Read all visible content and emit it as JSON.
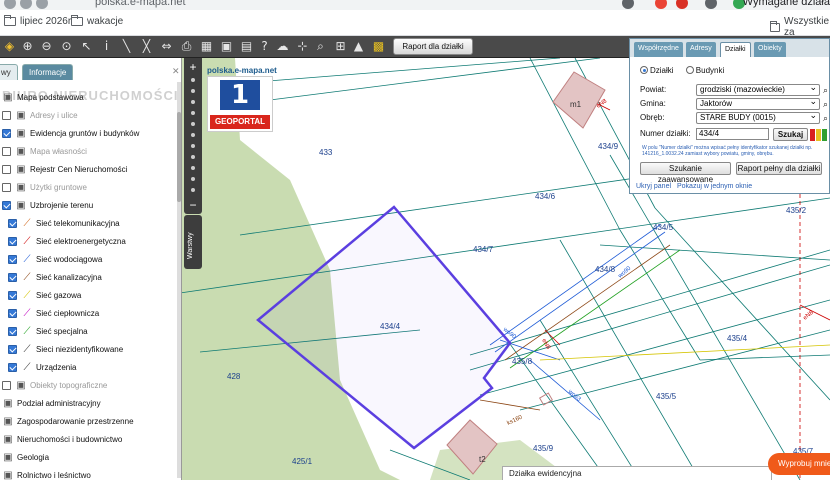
{
  "browser": {
    "url": "polska.e-mapa.net",
    "cta": "Wymagane działa",
    "bookmarks": [
      {
        "label": "lipiec 2026r"
      },
      {
        "label": "wakacje"
      },
      {
        "label": "Wszystkie za"
      }
    ]
  },
  "toolbar": {
    "raport_button": "Raport dla działki",
    "icons": [
      "layers-icon",
      "zoom-in-icon",
      "zoom-out-icon",
      "zoom-extent-icon",
      "pointer-icon",
      "info-icon",
      "measure-line-icon",
      "measure-area-icon",
      "pan-icon",
      "print-icon",
      "layout-icon",
      "bus-icon",
      "help-icon",
      "cloud-icon",
      "triangle-icon",
      "search-icon",
      "cart-icon",
      "grid-icon"
    ]
  },
  "watermark": "BIURO NIERUCHOMOŚCI",
  "left_panel": {
    "tabs": [
      {
        "label": "wy"
      },
      {
        "label": "Informacje"
      }
    ],
    "layers": [
      {
        "label": "Mapa podstawowa",
        "checked": null,
        "grey": false,
        "indent": 0
      },
      {
        "label": "Adresy i ulice",
        "checked": false,
        "grey": true,
        "indent": 0
      },
      {
        "label": "Ewidencja gruntów i budynków",
        "checked": true,
        "grey": false,
        "indent": 0
      },
      {
        "label": "Mapa własności",
        "checked": false,
        "grey": true,
        "indent": 0
      },
      {
        "label": "Rejestr Cen Nieruchomości",
        "checked": false,
        "grey": false,
        "indent": 0
      },
      {
        "label": "Użytki gruntowe",
        "checked": false,
        "grey": true,
        "indent": 0
      },
      {
        "label": "Uzbrojenie terenu",
        "checked": true,
        "grey": false,
        "indent": 0
      },
      {
        "label": "Sieć telekomunikacyjna",
        "checked": true,
        "grey": false,
        "indent": 1,
        "color": "#d2691e"
      },
      {
        "label": "Sieć elektroenergetyczna",
        "checked": true,
        "grey": false,
        "indent": 1,
        "color": "#cc0000"
      },
      {
        "label": "Sieć wodociągowa",
        "checked": true,
        "grey": false,
        "indent": 1,
        "color": "#1e5bd6"
      },
      {
        "label": "Sieć kanalizacyjna",
        "checked": true,
        "grey": false,
        "indent": 1,
        "color": "#8b4513"
      },
      {
        "label": "Sieć gazowa",
        "checked": true,
        "grey": false,
        "indent": 1,
        "color": "#d4c400"
      },
      {
        "label": "Sieć ciepłownicza",
        "checked": true,
        "grey": false,
        "indent": 1,
        "color": "#c000c0"
      },
      {
        "label": "Sieć specjalna",
        "checked": true,
        "grey": false,
        "indent": 1,
        "color": "#20a020"
      },
      {
        "label": "Sieci niezidentyfikowane",
        "checked": true,
        "grey": false,
        "indent": 1,
        "color": "#333333"
      },
      {
        "label": "Urządzenia",
        "checked": true,
        "grey": false,
        "indent": 1,
        "color": "#333333"
      },
      {
        "label": "Obiekty topograficzne",
        "checked": false,
        "grey": true,
        "indent": 0
      },
      {
        "label": "Podział administracyjny",
        "checked": null,
        "grey": false,
        "indent": 0
      },
      {
        "label": "Zagospodarowanie przestrzenne",
        "checked": null,
        "grey": false,
        "indent": 0
      },
      {
        "label": "Nieruchomości i budownictwo",
        "checked": null,
        "grey": false,
        "indent": 0
      },
      {
        "label": "Geologia",
        "checked": null,
        "grey": false,
        "indent": 0
      },
      {
        "label": "Rolnictwo i leśnictwo",
        "checked": null,
        "grey": false,
        "indent": 0
      },
      {
        "label": "Hydrografia",
        "checked": null,
        "grey": false,
        "indent": 0
      }
    ]
  },
  "warstwy_label": "Warstwy",
  "site_tag": "polska.e-mapa.net",
  "geoportal": {
    "number": "1",
    "label": "GEOPORTAL"
  },
  "search_panel": {
    "tabs": [
      {
        "label": "Współrzędne"
      },
      {
        "label": "Adresy"
      },
      {
        "label": "Działki",
        "active": true
      },
      {
        "label": "Obiekty"
      }
    ],
    "radio_dzialki": "Działki",
    "radio_budynki": "Budynki",
    "powiat_label": "Powiat:",
    "powiat_value": "grodziski (mazowieckie)",
    "gmina_label": "Gmina:",
    "gmina_value": "Jaktorów",
    "obreb_label": "Obręb:",
    "obreb_value": "STARE BUDY (0015)",
    "numer_label": "Numer działki:",
    "numer_value": "434/4",
    "szukaj_button": "Szukaj",
    "note": "W polu \"Numer działki\" można wpisać pełny identyfikator szukanej działki np. 141216_1.0032.24 zamiast wybory powiatu, gminy, obrębu.",
    "adv_button": "Szukanie zaawansowane",
    "report_button": "Raport pełny dla działki",
    "hide_link": "Ukryj panel",
    "window_link": "Pokazuj w jednym oknie",
    "status_colors": [
      "#d92020",
      "#e8c020",
      "#30a030"
    ]
  },
  "map": {
    "parcels": [
      "433",
      "434/4",
      "434/7",
      "434/6",
      "434/5",
      "434/8",
      "434/9",
      "435/8",
      "435/4",
      "435/5",
      "435/9",
      "435/2",
      "435/7",
      "428",
      "425/1"
    ],
    "building_labels": [
      "m1",
      "t2"
    ],
    "utility_labels": [
      "wo90",
      "wo90",
      "wo63",
      "ks160",
      "eN8",
      "eN8",
      "eN8"
    ]
  },
  "status_label": "Działka ewidencyjna",
  "promo_label": "Wyprobuj mnie"
}
